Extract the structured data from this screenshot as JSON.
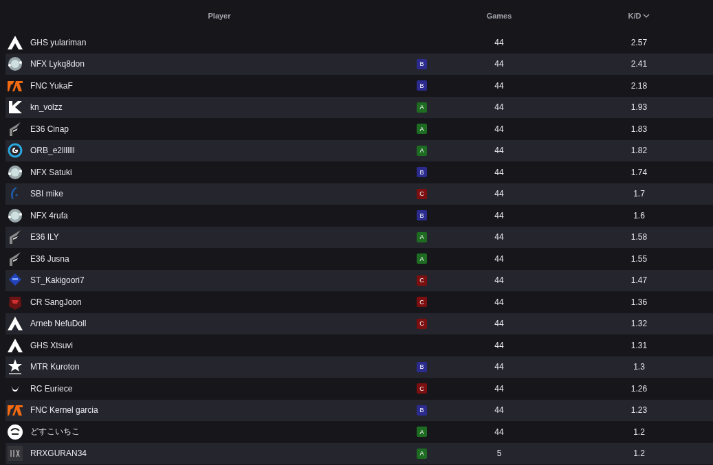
{
  "columns": [
    {
      "label": "Player",
      "sorted": false
    },
    {
      "label": "Games",
      "sorted": false
    },
    {
      "label": "K/D",
      "sorted": true
    }
  ],
  "rows": [
    {
      "kind": "apex",
      "player": "GHS yulariman",
      "games": "44",
      "kd": "2.57"
    },
    {
      "kind": "nfx",
      "player": "NFX Lykq8don",
      "tier": {
        "label": "B",
        "color": "#2b2c8e"
      },
      "games": "44",
      "kd": "2.41"
    },
    {
      "kind": "fnc",
      "player": "FNC YukaF",
      "tier": {
        "label": "B",
        "color": "#2b2c8e"
      },
      "games": "44",
      "kd": "2.18"
    },
    {
      "kind": "kn",
      "player": "kn_volzz",
      "tier": {
        "label": "A",
        "color": "#1e6b22"
      },
      "games": "44",
      "kd": "1.93"
    },
    {
      "kind": "e36",
      "player": "E36 Cinap",
      "tier": {
        "label": "A",
        "color": "#1e6b22"
      },
      "games": "44",
      "kd": "1.83"
    },
    {
      "kind": "orb",
      "player": "ORB_e2lllllll",
      "tier": {
        "label": "A",
        "color": "#1e6b22"
      },
      "games": "44",
      "kd": "1.82"
    },
    {
      "kind": "nfx",
      "player": "NFX Satuki",
      "tier": {
        "label": "B",
        "color": "#2b2c8e"
      },
      "games": "44",
      "kd": "1.74"
    },
    {
      "kind": "sbi",
      "player": "SBI mike",
      "tier": {
        "label": "C",
        "color": "#7c0f10"
      },
      "games": "44",
      "kd": "1.7"
    },
    {
      "kind": "nfx",
      "player": "NFX 4rufa",
      "tier": {
        "label": "B",
        "color": "#2b2c8e"
      },
      "games": "44",
      "kd": "1.6"
    },
    {
      "kind": "e36",
      "player": "E36 ILY",
      "tier": {
        "label": "A",
        "color": "#1e6b22"
      },
      "games": "44",
      "kd": "1.58"
    },
    {
      "kind": "e36",
      "player": "E36 Jusna",
      "tier": {
        "label": "A",
        "color": "#1e6b22"
      },
      "games": "44",
      "kd": "1.55"
    },
    {
      "kind": "st",
      "player": "ST_Kakigoori7",
      "tier": {
        "label": "C",
        "color": "#7c0f10"
      },
      "games": "44",
      "kd": "1.47"
    },
    {
      "kind": "cr",
      "player": "CR SangJoon",
      "tier": {
        "label": "C",
        "color": "#7c0f10"
      },
      "games": "44",
      "kd": "1.36"
    },
    {
      "kind": "apex",
      "player": "Arneb NefuDoll",
      "tier": {
        "label": "C",
        "color": "#7c0f10"
      },
      "games": "44",
      "kd": "1.32"
    },
    {
      "kind": "apex",
      "player": "GHS Xtsuvi",
      "games": "44",
      "kd": "1.31"
    },
    {
      "kind": "mtr",
      "player": "MTR Kuroton",
      "tier": {
        "label": "B",
        "color": "#2b2c8e"
      },
      "games": "44",
      "kd": "1.3"
    },
    {
      "kind": "rc",
      "player": "RC Euriece",
      "tier": {
        "label": "C",
        "color": "#7c0f10"
      },
      "games": "44",
      "kd": "1.26"
    },
    {
      "kind": "fnc",
      "player": "FNC Kernel garcia",
      "tier": {
        "label": "B",
        "color": "#2b2c8e"
      },
      "games": "44",
      "kd": "1.23"
    },
    {
      "kind": "dosu",
      "player": "どすこいちこ",
      "tier": {
        "label": "A",
        "color": "#1e6b22"
      },
      "games": "44",
      "kd": "1.2"
    },
    {
      "kind": "rrx",
      "player": "RRXGURAN34",
      "tier": {
        "label": "A",
        "color": "#1e6b22"
      },
      "games": "5",
      "kd": "1.2"
    }
  ]
}
